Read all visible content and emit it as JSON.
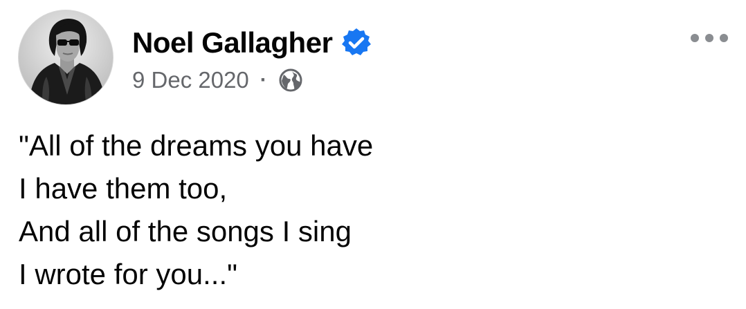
{
  "post": {
    "author": {
      "name": "Noel Gallagher",
      "verified": true,
      "avatar_icon": "profile-photo"
    },
    "meta": {
      "date": "9 Dec 2020",
      "separator": "·",
      "audience_icon": "globe-icon"
    },
    "more_options_icon": "more-horizontal-icon",
    "text_lines": [
      "\"All of the dreams you have",
      "I have them too,",
      "And all of the songs I sing",
      "I wrote for you...\""
    ]
  },
  "colors": {
    "name_text": "#050505",
    "meta_text": "#65676b",
    "verified_blue": "#1877f2",
    "more_dots": "#8a8d91",
    "background": "#ffffff"
  }
}
